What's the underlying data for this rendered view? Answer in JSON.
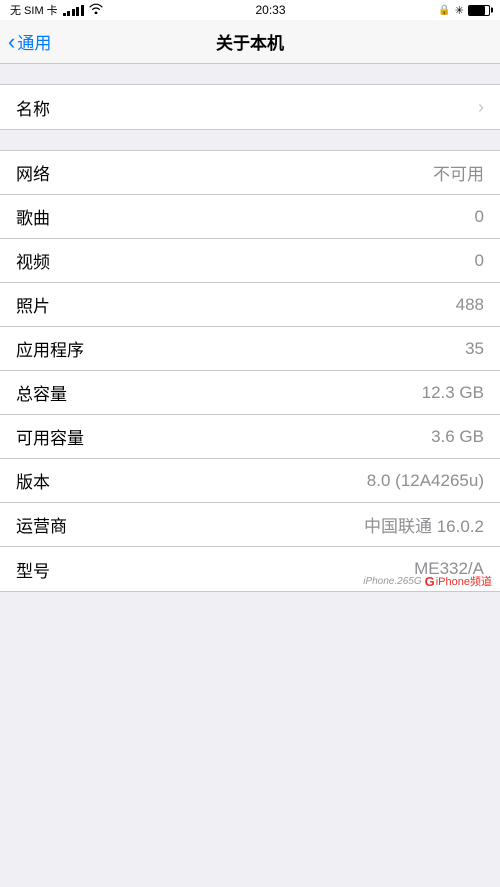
{
  "statusBar": {
    "carrier": "无 SIM 卡",
    "wifi": "WiFi",
    "time": "20:33",
    "lock": "🔒",
    "bluetooth": "✳",
    "battery": "80"
  },
  "navBar": {
    "backLabel": "通用",
    "title": "关于本机"
  },
  "rows": [
    {
      "label": "名称",
      "value": "",
      "hasChevron": true
    },
    {
      "label": "网络",
      "value": "不可用",
      "hasChevron": false
    },
    {
      "label": "歌曲",
      "value": "0",
      "hasChevron": false
    },
    {
      "label": "视频",
      "value": "0",
      "hasChevron": false
    },
    {
      "label": "照片",
      "value": "488",
      "hasChevron": false
    },
    {
      "label": "应用程序",
      "value": "35",
      "hasChevron": false
    },
    {
      "label": "总容量",
      "value": "12.3 GB",
      "hasChevron": false
    },
    {
      "label": "可用容量",
      "value": "3.6 GB",
      "hasChevron": false
    },
    {
      "label": "版本",
      "value": "8.0 (12A4265u)",
      "hasChevron": false
    },
    {
      "label": "运营商",
      "value": "中国联通 16.0.2",
      "hasChevron": false
    },
    {
      "label": "型号",
      "value": "ME332/A",
      "hasChevron": false
    }
  ],
  "watermark": {
    "site": "iPhone.265G",
    "brand": "G iPhone频道"
  }
}
